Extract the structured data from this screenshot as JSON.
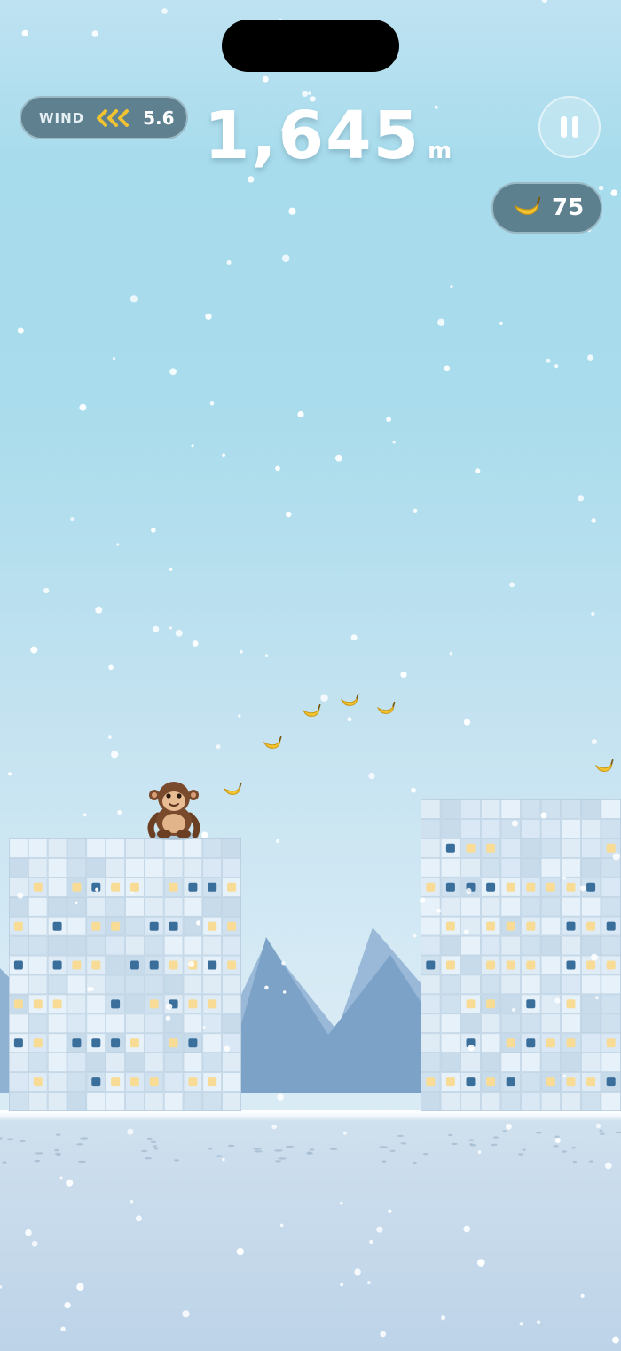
{
  "hud": {
    "wind_label": "WIND",
    "wind_direction": "left",
    "wind_value": "5.6",
    "score_value": "1,645",
    "score_unit": "m",
    "banana_count": "75"
  },
  "icons": {
    "wind": "chevron-left-triple-icon",
    "pause": "pause-icon",
    "banana": "banana-icon"
  },
  "colors": {
    "hud_pill": "#50707e",
    "wind_arrows": "#f1c232",
    "banana": "#f3c530",
    "monkey": "#7a4a2c",
    "window_lit": "#f8dc95",
    "window_dark": "#3a6f9c",
    "mountain": "#7ca3c7"
  }
}
